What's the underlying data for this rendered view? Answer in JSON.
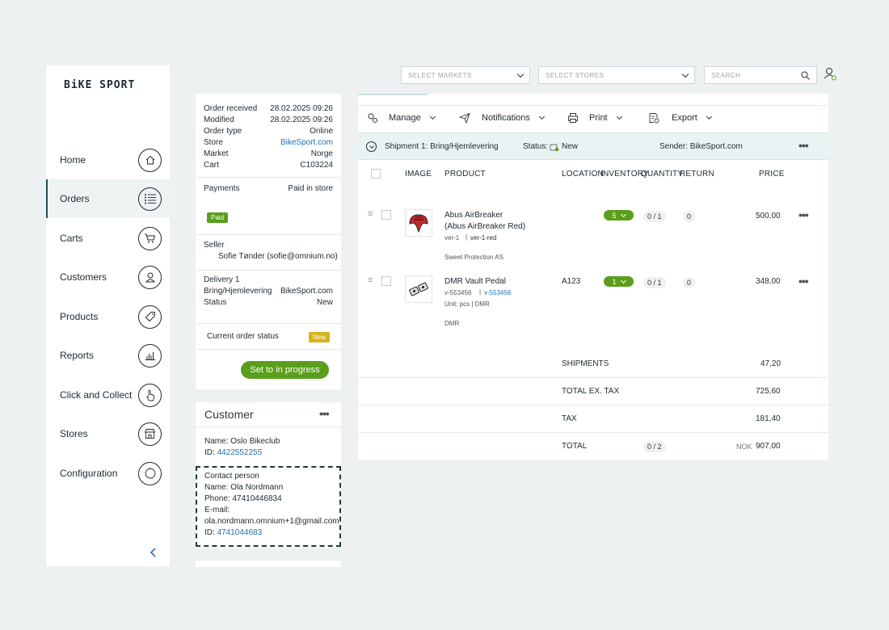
{
  "brand": "BiKE SPORT",
  "nav": {
    "items": [
      {
        "label": "Home",
        "icon": "home-icon"
      },
      {
        "label": "Orders",
        "icon": "list-icon"
      },
      {
        "label": "Carts",
        "icon": "cart-icon"
      },
      {
        "label": "Customers",
        "icon": "customer-icon"
      },
      {
        "label": "Products",
        "icon": "tag-icon"
      },
      {
        "label": "Reports",
        "icon": "chart-icon"
      },
      {
        "label": "Click and Collect",
        "icon": "hand-pointer-icon"
      },
      {
        "label": "Stores",
        "icon": "store-icon"
      },
      {
        "label": "Configuration",
        "icon": "gear-icon"
      }
    ],
    "active": "Orders"
  },
  "topbar": {
    "markets_placeholder": "SELECT MARKETS",
    "stores_placeholder": "SELECT STORES",
    "search_placeholder": "SEARCH"
  },
  "order_info": {
    "received_label": "Order received",
    "received_value": "28.02.2025 09:26",
    "modified_label": "Modified",
    "modified_value": "28.02.2025 09:26",
    "type_label": "Order type",
    "type_value": "Online",
    "store_label": "Store",
    "store_value": "BikeSport.com",
    "market_label": "Market",
    "market_value": "Norge",
    "cart_label": "Cart",
    "cart_value": "C103224",
    "payments_label": "Payments",
    "payments_value": "Paid in store",
    "paid_badge": "Paid",
    "seller_label": "Seller",
    "seller_value": "Sofie Tønder (sofie@omnium.no)",
    "delivery_label": "Delivery 1",
    "delivery_method": "Bring/Hjemlevering",
    "delivery_store": "BikeSport.com",
    "delivery_status_label": "Status",
    "delivery_status_value": "New",
    "current_status_label": "Current order status",
    "current_status_badge": "New",
    "progress_button": "Set to in progress"
  },
  "customer": {
    "title": "Customer",
    "name_line": "Name: Oslo Bikeclub",
    "id_prefix": "ID:",
    "id_value": "4422552255",
    "contact_title": "Contact person",
    "contact_name": "Name: Ola Nordmann",
    "contact_phone": "Phone: 47410446834",
    "contact_email_label": "E-mail:",
    "contact_email": "ola.nordmann.omnium+1@gmail.com",
    "contact_id_prefix": "ID:",
    "contact_id_value": "4741044683"
  },
  "toolbar": {
    "manage": "Manage",
    "notifications": "Notifications",
    "print": "Print",
    "export": "Export"
  },
  "shipment": {
    "title": "Shipment 1: Bring/Hjemlevering",
    "status_label": "Status:",
    "status_value": "New",
    "sender": "Sender: BikeSport.com"
  },
  "table": {
    "headers": {
      "image": "IMAGE",
      "product": "PRODUCT",
      "location": "LOCATION",
      "inventory": "INVENTORY",
      "quantity": "QUANTITY",
      "return": "RETURN",
      "price": "PRICE"
    },
    "rows": [
      {
        "name1": "Abus AirBreaker",
        "name2": "(Abus AirBreaker Red)",
        "variant": "ver-1",
        "variant_link": "ver-1-red",
        "extra": "",
        "supplier": "Sweet Protection AS",
        "location": "",
        "inventory": "5",
        "quantity": "0 / 1",
        "return": "0",
        "price": "500,00"
      },
      {
        "name1": "DMR Vault Pedal",
        "name2": "",
        "variant": "v-553456",
        "variant_link": "v-553456",
        "extra": "Unit: pcs  |  DMR",
        "supplier": "DMR",
        "location": "A123",
        "inventory": "1",
        "quantity": "0 / 1",
        "return": "0",
        "price": "348,00"
      }
    ]
  },
  "totals": {
    "shipments_label": "SHIPMENTS",
    "shipments_value": "47,20",
    "ex_tax_label": "TOTAL EX. TAX",
    "ex_tax_value": "725,60",
    "tax_label": "TAX",
    "tax_value": "181,40",
    "total_label": "TOTAL",
    "total_qty": "0 / 2",
    "currency": "NOK",
    "total_value": "907,00"
  }
}
